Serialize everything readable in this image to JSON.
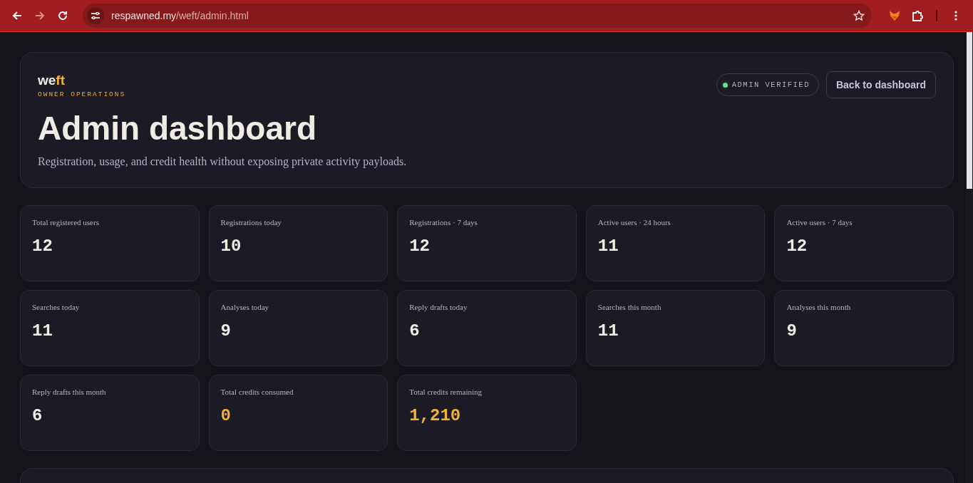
{
  "browser": {
    "back_disabled": false,
    "forward_disabled": true,
    "url_domain": "respawned.my",
    "url_path": "/weft/admin.html"
  },
  "header": {
    "logo": [
      {
        "text": "we",
        "accent": false
      },
      {
        "text": "ft",
        "accent": true
      }
    ],
    "eyebrow": "OWNER OPERATIONS",
    "title": "Admin dashboard",
    "subtitle": "Registration, usage, and credit health without exposing private activity payloads.",
    "status": {
      "label": "ADMIN VERIFIED",
      "on": true
    },
    "back_button": "Back to dashboard"
  },
  "stats": [
    {
      "label": "Total registered users",
      "value": "12",
      "accent": false
    },
    {
      "label": "Registrations today",
      "value": "10",
      "accent": false
    },
    {
      "label": "Registrations · 7 days",
      "value": "12",
      "accent": false
    },
    {
      "label": "Active users · 24 hours",
      "value": "11",
      "accent": false
    },
    {
      "label": "Active users · 7 days",
      "value": "12",
      "accent": false
    },
    {
      "label": "Searches today",
      "value": "11",
      "accent": false
    },
    {
      "label": "Analyses today",
      "value": "9",
      "accent": false
    },
    {
      "label": "Reply drafts today",
      "value": "6",
      "accent": false
    },
    {
      "label": "Searches this month",
      "value": "11",
      "accent": false
    },
    {
      "label": "Analyses this month",
      "value": "9",
      "accent": false
    },
    {
      "label": "Reply drafts this month",
      "value": "6",
      "accent": false
    },
    {
      "label": "Total credits consumed",
      "value": "0",
      "accent": true
    },
    {
      "label": "Total credits remaining",
      "value": "1,210",
      "accent": true
    }
  ]
}
